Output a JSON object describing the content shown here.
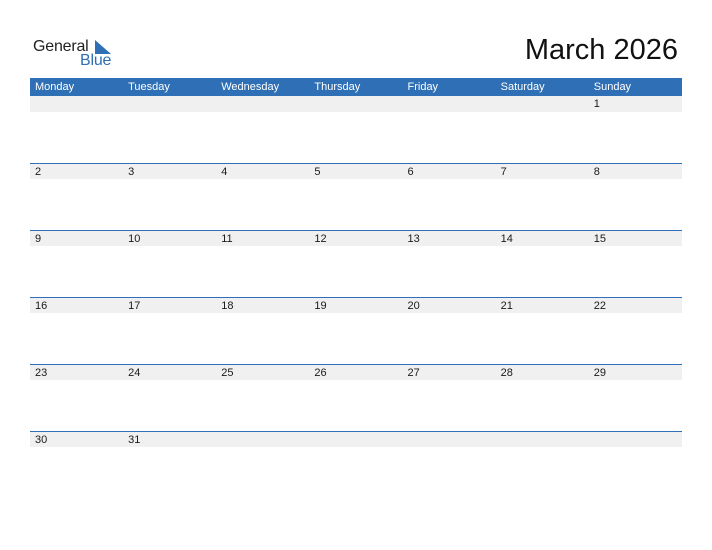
{
  "logo": {
    "word1": "General",
    "word2": "Blue"
  },
  "title": "March 2026",
  "weekdays": [
    "Monday",
    "Tuesday",
    "Wednesday",
    "Thursday",
    "Friday",
    "Saturday",
    "Sunday"
  ],
  "weeks": [
    [
      "",
      "",
      "",
      "",
      "",
      "",
      "1"
    ],
    [
      "2",
      "3",
      "4",
      "5",
      "6",
      "7",
      "8"
    ],
    [
      "9",
      "10",
      "11",
      "12",
      "13",
      "14",
      "15"
    ],
    [
      "16",
      "17",
      "18",
      "19",
      "20",
      "21",
      "22"
    ],
    [
      "23",
      "24",
      "25",
      "26",
      "27",
      "28",
      "29"
    ],
    [
      "30",
      "31",
      "",
      "",
      "",
      "",
      ""
    ]
  ],
  "colors": {
    "accent": "#2f6fb5",
    "row_bg": "#f0f0f0"
  }
}
